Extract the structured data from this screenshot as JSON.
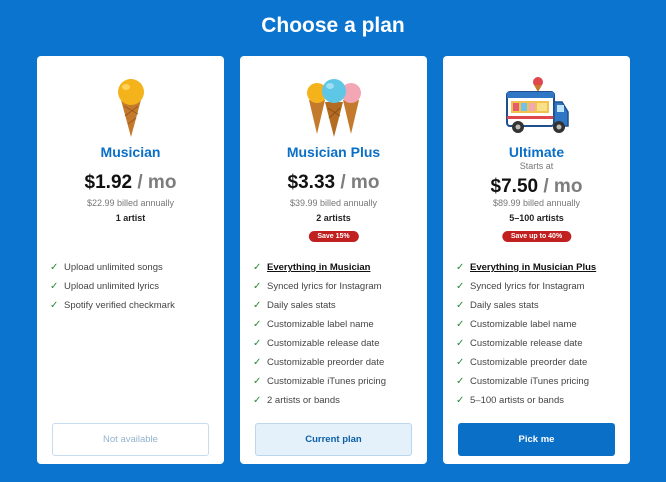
{
  "page": {
    "title": "Choose a plan"
  },
  "colors": {
    "background": "#0a74cf",
    "accent": "#0a6fc6",
    "badge": "#c0201f",
    "check": "#2a8a3a"
  },
  "plans": [
    {
      "name": "Musician",
      "starts_at": "",
      "price": "$1.92",
      "per": " / mo",
      "billed": "$22.99 billed annually",
      "artists": "1 artist",
      "badge": "",
      "illustration": "single-ice-cream-cone-icon",
      "features": [
        "Upload unlimited songs",
        "Upload unlimited lyrics",
        "Spotify verified checkmark"
      ],
      "button": "Not available"
    },
    {
      "name": "Musician Plus",
      "starts_at": "",
      "price": "$3.33",
      "per": " / mo",
      "billed": "$39.99 billed annually",
      "artists": "2 artists",
      "badge": "Save 15%",
      "illustration": "three-ice-cream-cones-icon",
      "features": [
        "Everything in Musician",
        "Synced lyrics for Instagram",
        "Daily sales stats",
        "Customizable label name",
        "Customizable release date",
        "Customizable preorder date",
        "Customizable iTunes pricing",
        "2 artists or bands"
      ],
      "button": "Current plan"
    },
    {
      "name": "Ultimate",
      "starts_at": "Starts at",
      "price": "$7.50",
      "per": " / mo",
      "billed": "$89.99 billed annually",
      "artists": "5–100 artists",
      "badge": "Save up to 40%",
      "illustration": "ice-cream-truck-icon",
      "features": [
        "Everything in Musician Plus",
        "Synced lyrics for Instagram",
        "Daily sales stats",
        "Customizable label name",
        "Customizable release date",
        "Customizable preorder date",
        "Customizable iTunes pricing",
        "5–100 artists or bands"
      ],
      "button": "Pick me"
    }
  ]
}
